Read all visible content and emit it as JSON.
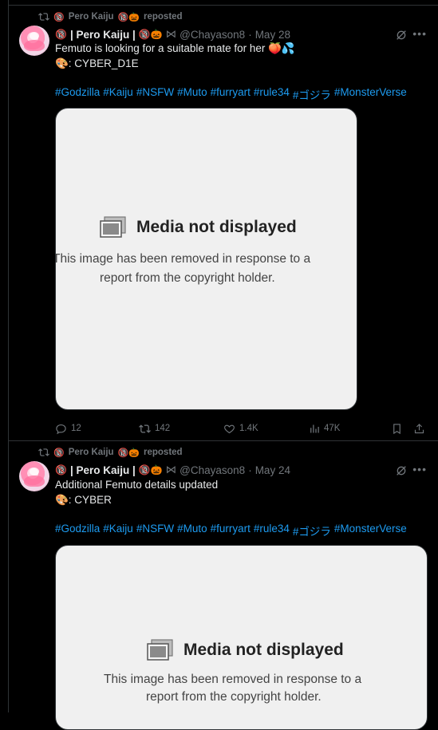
{
  "posts": [
    {
      "repost_by": "Pero Kaiju",
      "repost_badge": "🔞",
      "repost_suffix": "🔞🎃",
      "repost_action": "reposted",
      "author_prefix": "🔞",
      "author_name": "| Pero Kaiju |",
      "author_suffix": "🔞🎃",
      "author_extra": "⋈",
      "handle": "@Chayason8",
      "separator": "·",
      "date": "May 28",
      "text_line1": "Femuto is looking for a suitable mate for her 🍑💦",
      "text_line2": "🎨: CYBER_D1E",
      "hashtags": [
        "#Godzilla",
        "#Kaiju",
        "#NSFW",
        "#Muto",
        "#furryart",
        "#rule34",
        "#ゴジラ",
        "#MonsterVerse"
      ],
      "media_title": "Media not displayed",
      "media_sub_line1": "This image has been removed in response to a",
      "media_sub_line2": "report from the copyright holder.",
      "replies": "12",
      "reposts": "142",
      "likes": "1.4K",
      "views": "47K"
    },
    {
      "repost_by": "Pero Kaiju",
      "repost_badge": "🔞",
      "repost_suffix": "🔞🎃",
      "repost_action": "reposted",
      "author_prefix": "🔞",
      "author_name": "| Pero Kaiju |",
      "author_suffix": "🔞🎃",
      "author_extra": "⋈",
      "handle": "@Chayason8",
      "separator": "·",
      "date": "May 24",
      "text_line1": "Additional Femuto details updated",
      "text_line2": "🎨: CYBER",
      "hashtags": [
        "#Godzilla",
        "#Kaiju",
        "#NSFW",
        "#Muto",
        "#furryart",
        "#rule34",
        "#ゴジラ",
        "#MonsterVerse"
      ],
      "media_title": "Media not displayed",
      "media_sub_line1": "This image has been removed in response to a",
      "media_sub_line2": "report from the copyright holder."
    }
  ],
  "colors": {
    "background": "#000000",
    "text": "#e7e9ea",
    "muted": "#71767b",
    "link": "#1d9bf0",
    "border": "#2f3336",
    "media_bg": "#f0f0f0"
  },
  "icons": [
    "repost-icon",
    "grok-icon",
    "more-icon",
    "reply-icon",
    "like-icon",
    "views-icon",
    "bookmark-icon",
    "share-icon",
    "image-icon"
  ]
}
